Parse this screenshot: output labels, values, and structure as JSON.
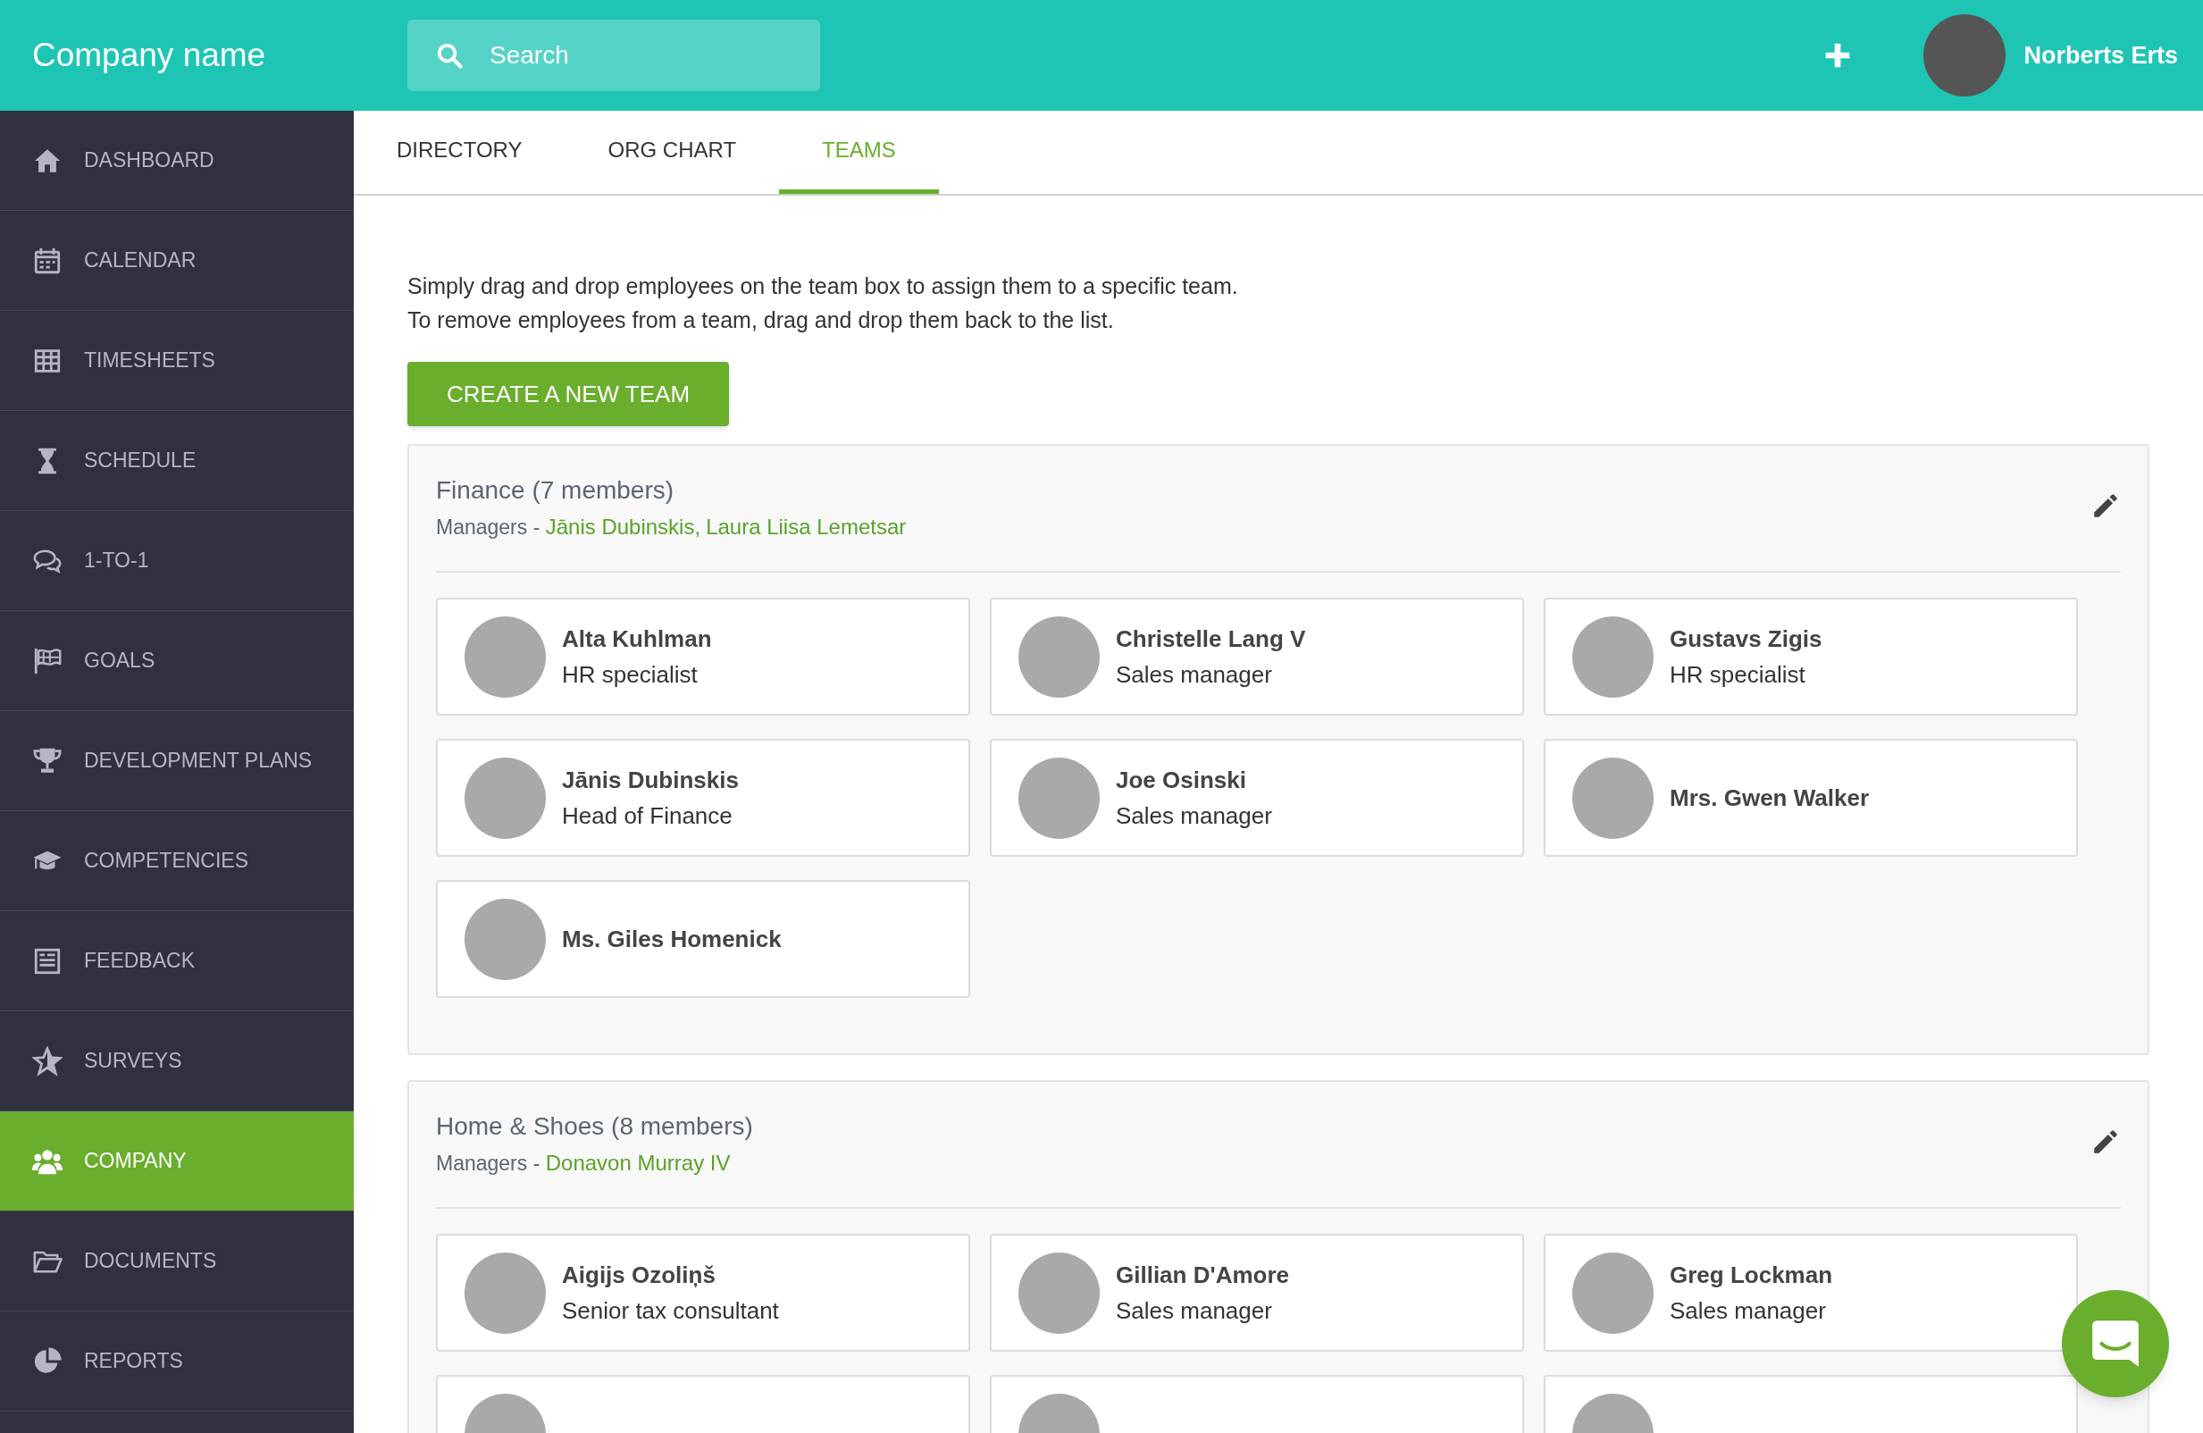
{
  "header": {
    "company_name": "Company name",
    "search": {
      "placeholder": "Search"
    },
    "user": {
      "name": "Norberts Erts"
    }
  },
  "sidebar": {
    "items": [
      {
        "label": "DASHBOARD",
        "selected": false
      },
      {
        "label": "CALENDAR",
        "selected": false
      },
      {
        "label": "TIMESHEETS",
        "selected": false
      },
      {
        "label": "SCHEDULE",
        "selected": false
      },
      {
        "label": "1-TO-1",
        "selected": false
      },
      {
        "label": "GOALS",
        "selected": false
      },
      {
        "label": "DEVELOPMENT PLANS",
        "selected": false
      },
      {
        "label": "COMPETENCIES",
        "selected": false
      },
      {
        "label": "FEEDBACK",
        "selected": false
      },
      {
        "label": "SURVEYS",
        "selected": false
      },
      {
        "label": "COMPANY",
        "selected": true
      },
      {
        "label": "DOCUMENTS",
        "selected": false
      },
      {
        "label": "REPORTS",
        "selected": false
      }
    ]
  },
  "tabs": [
    {
      "label": "DIRECTORY",
      "selected": false
    },
    {
      "label": "ORG CHART",
      "selected": false
    },
    {
      "label": "TEAMS",
      "selected": true
    }
  ],
  "instructions": [
    "Simply drag and drop employees on the team box to assign them to a specific team.",
    "To remove employees from a team, drag and drop them back to the list."
  ],
  "create_button": "CREATE A NEW TEAM",
  "teams": [
    {
      "title": "Finance (7 members)",
      "managers_label": "Managers - ",
      "manager_separator": ",",
      "managers": [
        "Jānis Dubinskis",
        "Laura Liisa Lemetsar"
      ],
      "members": [
        {
          "kind": "full",
          "name": "Alta Kuhlman",
          "role": "HR specialist"
        },
        {
          "kind": "full",
          "name": "Christelle Lang V",
          "role": "Sales manager"
        },
        {
          "kind": "full",
          "name": "Gustavs Zigis",
          "role": "HR specialist"
        },
        {
          "kind": "full",
          "name": "Jānis Dubinskis",
          "role": "Head of Finance"
        },
        {
          "kind": "full",
          "name": "Joe Osinski",
          "role": "Sales manager"
        },
        {
          "kind": "full",
          "name": "Mrs. Gwen Walker"
        },
        {
          "kind": "full",
          "name": "Ms. Giles Homenick"
        }
      ]
    },
    {
      "title": "Home & Shoes (8 members)",
      "managers_label": "Managers - ",
      "managers": [
        "Donavon Murray IV"
      ],
      "members": [
        {
          "kind": "full",
          "name": "Aigijs Ozoliņš",
          "role": "Senior tax consultant"
        },
        {
          "kind": "full",
          "name": "Gillian D'Amore",
          "role": "Sales manager"
        },
        {
          "kind": "full",
          "name": "Greg Lockman",
          "role": "Sales manager"
        },
        {
          "kind": "cut"
        },
        {
          "kind": "cut"
        },
        {
          "kind": "cut"
        }
      ]
    }
  ]
}
